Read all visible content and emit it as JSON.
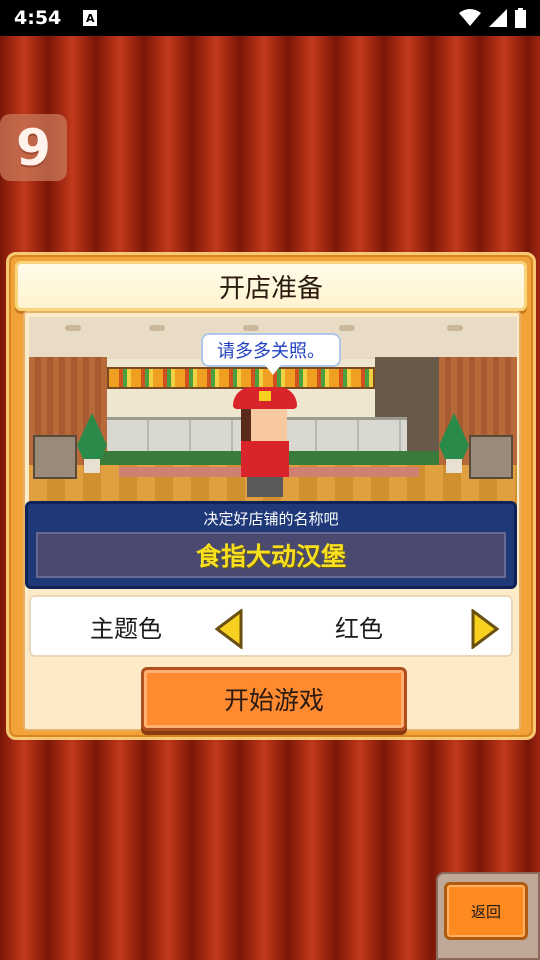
{
  "status_bar": {
    "time": "4:54",
    "notification_icon": "A"
  },
  "day_badge": "9",
  "dialog": {
    "title": "开店准备",
    "speech_bubble": "请多多关照。",
    "name_prompt": "决定好店铺的名称吧",
    "store_name": "食指大动汉堡",
    "theme_label": "主题色",
    "theme_value": "红色",
    "start_button": "开始游戏"
  },
  "back_button": "返回",
  "colors": {
    "curtain": "#a62a12",
    "dialog_orange": "#f1a33a",
    "name_panel": "#1e3878",
    "store_name_text": "#f8e020",
    "speech_text": "#2040c0",
    "arrow": "#f8d020"
  }
}
